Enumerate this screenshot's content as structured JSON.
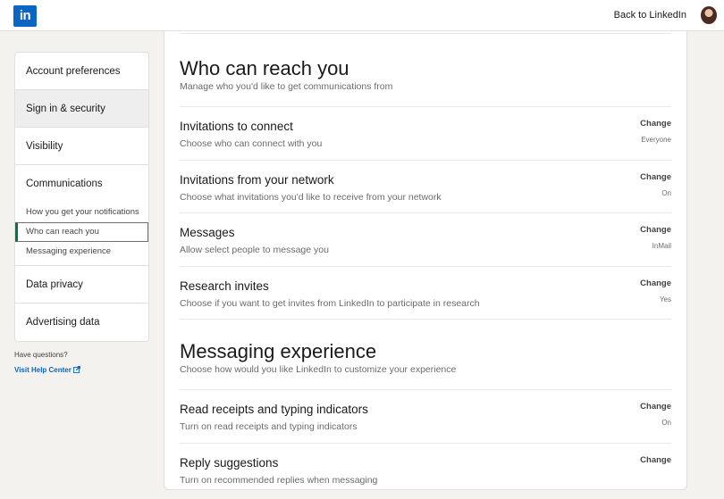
{
  "header": {
    "logo_text": "in",
    "back_link": "Back to LinkedIn"
  },
  "sidebar": {
    "items": [
      {
        "label": "Account preferences"
      },
      {
        "label": "Sign in & security"
      },
      {
        "label": "Visibility"
      },
      {
        "label": "Communications"
      }
    ],
    "sub_items": [
      {
        "label": "How you get your notifications"
      },
      {
        "label": "Who can reach you"
      },
      {
        "label": "Messaging experience"
      }
    ],
    "items_after": [
      {
        "label": "Data privacy"
      },
      {
        "label": "Advertising data"
      }
    ],
    "help_question": "Have questions?",
    "help_link": "Visit Help Center"
  },
  "sections": [
    {
      "title": "Who can reach you",
      "subtitle": "Manage who you'd like to get communications from",
      "rows": [
        {
          "title": "Invitations to connect",
          "desc": "Choose who can connect with you",
          "action": "Change",
          "value": "Everyone"
        },
        {
          "title": "Invitations from your network",
          "desc": "Choose what invitations you'd like to receive from your network",
          "action": "Change",
          "value": "On"
        },
        {
          "title": "Messages",
          "desc": "Allow select people to message you",
          "action": "Change",
          "value": "InMail"
        },
        {
          "title": "Research invites",
          "desc": "Choose if you want to get invites from LinkedIn to participate in research",
          "action": "Change",
          "value": "Yes"
        }
      ]
    },
    {
      "title": "Messaging experience",
      "subtitle": "Choose how would you like LinkedIn to customize your experience",
      "rows": [
        {
          "title": "Read receipts and typing indicators",
          "desc": "Turn on read receipts and typing indicators",
          "action": "Change",
          "value": "On"
        },
        {
          "title": "Reply suggestions",
          "desc": "Turn on recommended replies when messaging",
          "action": "Change",
          "value": ""
        }
      ]
    }
  ],
  "colors": {
    "brand": "#0a66c2",
    "selected_accent": "#057642",
    "background": "#f3f2ef"
  }
}
